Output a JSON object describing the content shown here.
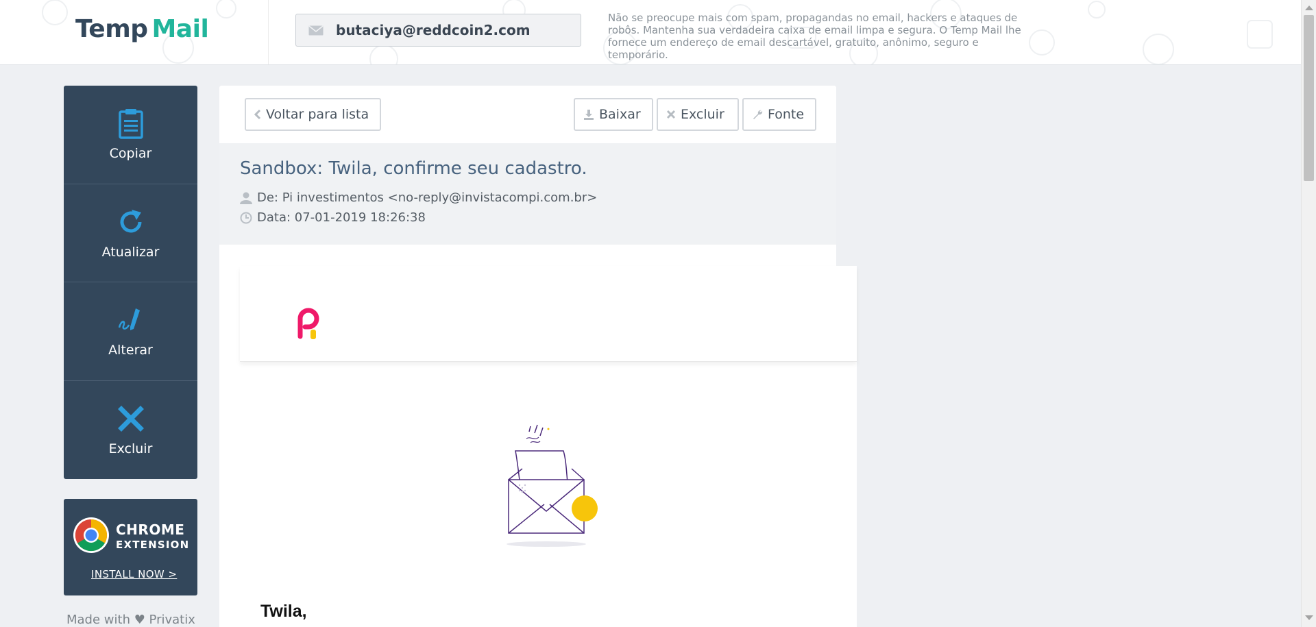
{
  "header": {
    "logo_part1": "Temp",
    "logo_part2": "Mail",
    "email_address": "butaciya@reddcoin2.com",
    "tagline": "Não se preocupe mais com spam, propagandas no email, hackers e ataques de robôs. Mantenha sua verdadeira caixa de email limpa e segura. O Temp Mail lhe fornece um endereço de email descartável, gratuito, anônimo, seguro e temporário."
  },
  "sidebar": {
    "items": [
      {
        "label": "Copiar",
        "icon": "clipboard-icon"
      },
      {
        "label": "Atualizar",
        "icon": "refresh-icon"
      },
      {
        "label": "Alterar",
        "icon": "pen-icon"
      },
      {
        "label": "Excluir",
        "icon": "close-icon"
      }
    ]
  },
  "chrome_ad": {
    "line1": "CHROME",
    "line2": "EXTENSION",
    "cta": "INSTALL NOW >"
  },
  "footer": {
    "made_with": "Made with ♥ Privatix"
  },
  "message": {
    "back_label": "Voltar para lista",
    "download_label": "Baixar",
    "delete_label": "Excluir",
    "source_label": "Fonte",
    "subject": "Sandbox: Twila, confirme seu cadastro.",
    "from": "De: Pi investimentos <no-reply@invistacompi.com.br>",
    "date": "Data: 07-01-2019 18:26:38",
    "greeting": "Twila,"
  },
  "colors": {
    "sidebar_bg": "#33475b",
    "accent_blue": "#2d9cdb",
    "logo_green": "#21b59b",
    "brand_pink": "#ef1a69",
    "brand_yellow": "#f7c50b",
    "envelope_purple": "#4b2a7b"
  }
}
